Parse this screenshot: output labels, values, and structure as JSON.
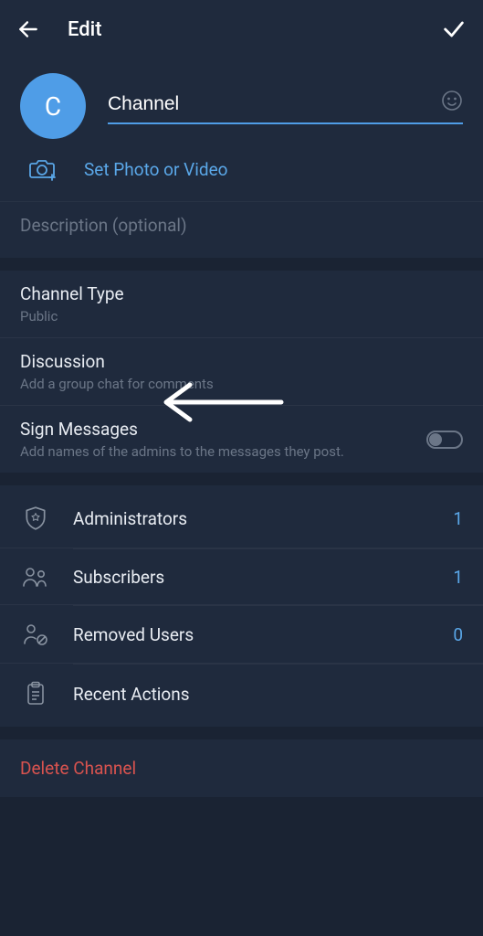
{
  "header": {
    "title": "Edit"
  },
  "avatar_letter": "C",
  "channel_name": "Channel",
  "set_photo_label": "Set Photo or Video",
  "description_placeholder": "Description (optional)",
  "settings": {
    "channel_type": {
      "label": "Channel Type",
      "value": "Public"
    },
    "discussion": {
      "label": "Discussion",
      "hint": "Add a group chat for comments"
    },
    "sign_messages": {
      "label": "Sign Messages",
      "hint": "Add names of the admins to the messages they post.",
      "enabled": false
    }
  },
  "management": {
    "administrators": {
      "label": "Administrators",
      "count": "1"
    },
    "subscribers": {
      "label": "Subscribers",
      "count": "1"
    },
    "removed_users": {
      "label": "Removed Users",
      "count": "0"
    },
    "recent_actions": {
      "label": "Recent Actions"
    }
  },
  "delete_label": "Delete Channel"
}
